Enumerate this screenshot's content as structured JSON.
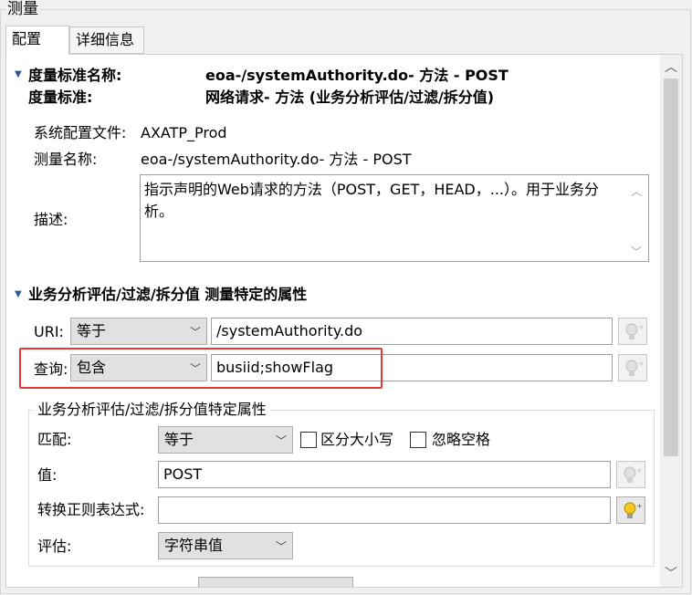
{
  "group_title": "测量",
  "tabs": [
    {
      "label": "配置"
    },
    {
      "label": "详细信息"
    }
  ],
  "header": {
    "metric_name_label": "度量标准名称:",
    "metric_name_value": "eoa-/systemAuthority.do- 方法 - POST",
    "metric_label": "度量标准:",
    "metric_value": "网络请求- 方法 (业务分析评估/过滤/拆分值)"
  },
  "details": {
    "sysconfig_label": "系统配置文件:",
    "sysconfig_value": "AXATP_Prod",
    "measure_name_label": "测量名称:",
    "measure_name_value": "eoa-/systemAuthority.do- 方法 - POST",
    "desc_label": "描述:",
    "desc_value": "指示声明的Web请求的方法（POST，GET，HEAD，...）。用于业务分析。"
  },
  "section2_title": "业务分析评估/过滤/拆分值 测量特定的属性",
  "uri_row": {
    "label": "URI:",
    "operator": "等于",
    "value": "/systemAuthority.do"
  },
  "query_row": {
    "label": "查询:",
    "operator": "包含",
    "value": "busiid;showFlag"
  },
  "inner_group": {
    "title": "业务分析评估/过滤/拆分值特定属性",
    "match_label": "匹配:",
    "match_operator": "等于",
    "case_label": "区分大小写",
    "ignore_space_label": "忽略空格",
    "value_label": "值:",
    "value_value": "POST",
    "regex_label": "转换正则表达式:",
    "regex_value": "",
    "eval_label": "评估:",
    "eval_value": "字符串值"
  },
  "colors": {
    "highlight_box": "#e53935",
    "bulb_active": "#f6c81e"
  }
}
